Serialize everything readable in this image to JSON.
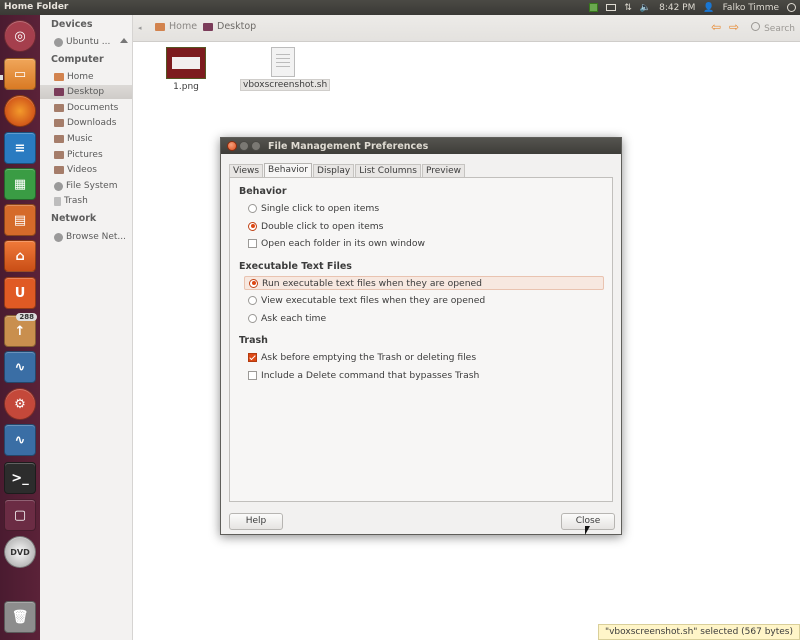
{
  "top_panel": {
    "title": "Home Folder",
    "time": "8:42 PM",
    "user": "Falko Timme"
  },
  "launcher": {
    "items": [
      {
        "icon": "dash-home-icon"
      },
      {
        "icon": "files-icon"
      },
      {
        "icon": "firefox-icon"
      },
      {
        "icon": "libreoffice-writer-icon"
      },
      {
        "icon": "libreoffice-calc-icon"
      },
      {
        "icon": "libreoffice-impress-icon"
      },
      {
        "icon": "software-center-icon"
      },
      {
        "icon": "ubuntu-one-icon"
      },
      {
        "icon": "update-manager-icon",
        "badge": "288"
      },
      {
        "icon": "system-monitor-icon"
      },
      {
        "icon": "system-settings-icon"
      },
      {
        "icon": "system-monitor-2-icon"
      },
      {
        "icon": "terminal-icon"
      },
      {
        "icon": "workspace-switcher-icon"
      },
      {
        "icon": "dvd-icon"
      },
      {
        "icon": "trash-icon"
      }
    ]
  },
  "sidebar": {
    "devices_label": "Devices",
    "devices": [
      {
        "label": "Ubuntu ..."
      }
    ],
    "computer_label": "Computer",
    "computer": [
      {
        "label": "Home"
      },
      {
        "label": "Desktop"
      },
      {
        "label": "Documents"
      },
      {
        "label": "Downloads"
      },
      {
        "label": "Music"
      },
      {
        "label": "Pictures"
      },
      {
        "label": "Videos"
      },
      {
        "label": "File System"
      },
      {
        "label": "Trash"
      }
    ],
    "network_label": "Network",
    "network": [
      {
        "label": "Browse Net..."
      }
    ]
  },
  "toolbar": {
    "crumbs": [
      "Home",
      "Desktop"
    ],
    "search": "Search"
  },
  "files": [
    {
      "name": "1.png"
    },
    {
      "name": "vboxscreenshot.sh"
    }
  ],
  "dialog": {
    "title": "File Management Preferences",
    "tabs": [
      "Views",
      "Behavior",
      "Display",
      "List Columns",
      "Preview"
    ],
    "behavior": {
      "heading": "Behavior",
      "options": [
        "Single click to open items",
        "Double click to open items",
        "Open each folder in its own window"
      ]
    },
    "exec": {
      "heading": "Executable Text Files",
      "options": [
        "Run executable text files when they are opened",
        "View executable text files when they are opened",
        "Ask each time"
      ]
    },
    "trash": {
      "heading": "Trash",
      "options": [
        "Ask before emptying the Trash or deleting files",
        "Include a Delete command that bypasses Trash"
      ]
    },
    "help_label": "Help",
    "close_label": "Close"
  },
  "status_bar": "\"vboxscreenshot.sh\" selected (567 bytes)",
  "colors": {
    "accent": "#dd4814",
    "launcher": "#5b2238",
    "panel": "#3c3b37"
  }
}
